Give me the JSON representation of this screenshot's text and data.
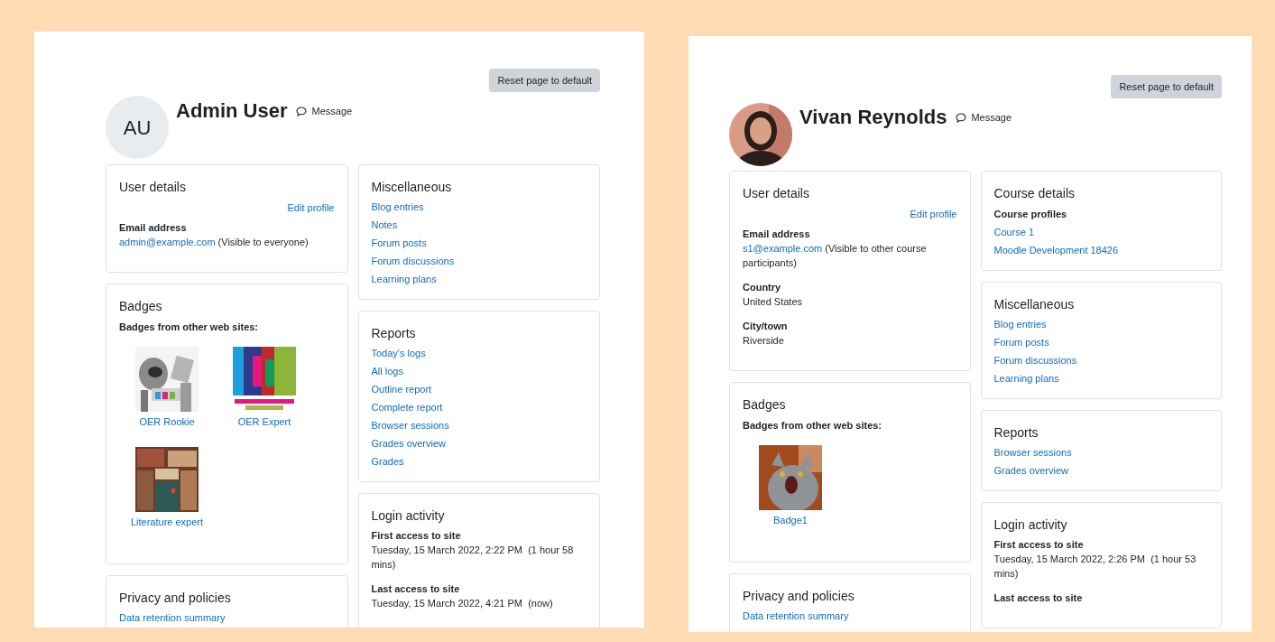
{
  "panels": [
    {
      "reset_button": "Reset page to default",
      "avatar": {
        "kind": "initials",
        "text": "AU"
      },
      "name": "Admin User",
      "message": "Message",
      "left_column": [
        {
          "title": "User details",
          "items": [
            {
              "kind": "action",
              "text": "Edit profile"
            },
            {
              "kind": "field",
              "label": "Email address",
              "link": "admin@example.com",
              "note": "(Visible to everyone)"
            }
          ]
        },
        {
          "title": "Badges",
          "items": [
            {
              "kind": "heading",
              "text": "Badges from other web sites:"
            }
          ],
          "badges": [
            {
              "label": "OER Rookie"
            },
            {
              "label": "OER Expert"
            },
            {
              "label": "Literature expert"
            }
          ]
        },
        {
          "title": "Privacy and policies",
          "items": [
            {
              "kind": "link",
              "text": "Data retention summary"
            }
          ]
        }
      ],
      "right_column": [
        {
          "title": "Miscellaneous",
          "items": [
            {
              "kind": "link",
              "text": "Blog entries"
            },
            {
              "kind": "link",
              "text": "Notes"
            },
            {
              "kind": "link",
              "text": "Forum posts"
            },
            {
              "kind": "link",
              "text": "Forum discussions"
            },
            {
              "kind": "link",
              "text": "Learning plans"
            }
          ]
        },
        {
          "title": "Reports",
          "items": [
            {
              "kind": "link",
              "text": "Today's logs"
            },
            {
              "kind": "link",
              "text": "All logs"
            },
            {
              "kind": "link",
              "text": "Outline report"
            },
            {
              "kind": "link",
              "text": "Complete report"
            },
            {
              "kind": "link",
              "text": "Browser sessions"
            },
            {
              "kind": "link",
              "text": "Grades overview"
            },
            {
              "kind": "link",
              "text": "Grades"
            }
          ]
        },
        {
          "title": "Login activity",
          "items": [
            {
              "kind": "field",
              "label": "First access to site",
              "value": "Tuesday, 15 March 2022, 2:22 PM  (1 hour 58 mins)"
            },
            {
              "kind": "field",
              "label": "Last access to site",
              "value": "Tuesday, 15 March 2022, 4:21 PM  (now)"
            }
          ]
        }
      ]
    },
    {
      "reset_button": "Reset page to default",
      "avatar": {
        "kind": "picture"
      },
      "name": "Vivan Reynolds",
      "message": "Message",
      "left_column": [
        {
          "title": "User details",
          "items": [
            {
              "kind": "action",
              "text": "Edit profile"
            },
            {
              "kind": "field",
              "label": "Email address",
              "link": "s1@example.com",
              "note": "(Visible to other course participants)"
            },
            {
              "kind": "field",
              "label": "Country",
              "value": "United States"
            },
            {
              "kind": "field",
              "label": "City/town",
              "value": "Riverside"
            }
          ]
        },
        {
          "title": "Badges",
          "items": [
            {
              "kind": "heading",
              "text": "Badges from other web sites:"
            }
          ],
          "badges": [
            {
              "label": "Badge1"
            }
          ]
        },
        {
          "title": "Privacy and policies",
          "items": [
            {
              "kind": "link",
              "text": "Data retention summary"
            }
          ]
        }
      ],
      "right_column": [
        {
          "title": "Course details",
          "items": [
            {
              "kind": "heading",
              "text": "Course profiles"
            },
            {
              "kind": "link",
              "text": "Course 1"
            },
            {
              "kind": "link",
              "text": "Moodle Development 18426"
            }
          ]
        },
        {
          "title": "Miscellaneous",
          "items": [
            {
              "kind": "link",
              "text": "Blog entries"
            },
            {
              "kind": "link",
              "text": "Forum posts"
            },
            {
              "kind": "link",
              "text": "Forum discussions"
            },
            {
              "kind": "link",
              "text": "Learning plans"
            }
          ]
        },
        {
          "title": "Reports",
          "items": [
            {
              "kind": "link",
              "text": "Browser sessions"
            },
            {
              "kind": "link",
              "text": "Grades overview"
            }
          ]
        },
        {
          "title": "Login activity",
          "items": [
            {
              "kind": "field",
              "label": "First access to site",
              "value": "Tuesday, 15 March 2022, 2:26 PM  (1 hour 53 mins)"
            },
            {
              "kind": "field",
              "label": "Last access to site"
            }
          ]
        }
      ]
    }
  ]
}
